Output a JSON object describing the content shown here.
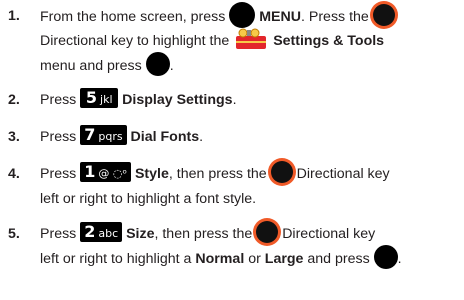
{
  "steps": [
    {
      "number": "1.",
      "text": {
        "a": "From the home screen, press",
        "menu": "MENU",
        "b": ". Press the",
        "c": "Directional key to highlight the",
        "settings": "Settings & Tools",
        "d": "menu and press",
        "e": "."
      }
    },
    {
      "number": "2.",
      "text": {
        "press": "Press",
        "key_num": "5",
        "key_letters": "jkl",
        "label": "Display Settings",
        "end": "."
      }
    },
    {
      "number": "3.",
      "text": {
        "press": "Press",
        "key_num": "7",
        "key_letters": "pqrs",
        "label": "Dial Fonts",
        "end": "."
      }
    },
    {
      "number": "4.",
      "text": {
        "press": "Press",
        "key_num": "1",
        "key_letters": "@ ◌ᵒ",
        "label": "Style",
        "a": ", then press the",
        "b": "Directional key",
        "c": "left or right to highlight a font style."
      }
    },
    {
      "number": "5.",
      "text": {
        "press": "Press",
        "key_num": "2",
        "key_letters": "abc",
        "label": "Size",
        "a": ", then press the",
        "b": "Directional key",
        "c": "left or right to highlight a",
        "normal": "Normal",
        "or": "or",
        "large": "Large",
        "d": "and press",
        "e": "."
      }
    }
  ],
  "colors": {
    "text": "#231f20",
    "key_bg": "#000000",
    "directional_ring": "#f05a28",
    "tools_red": "#e3262b"
  }
}
